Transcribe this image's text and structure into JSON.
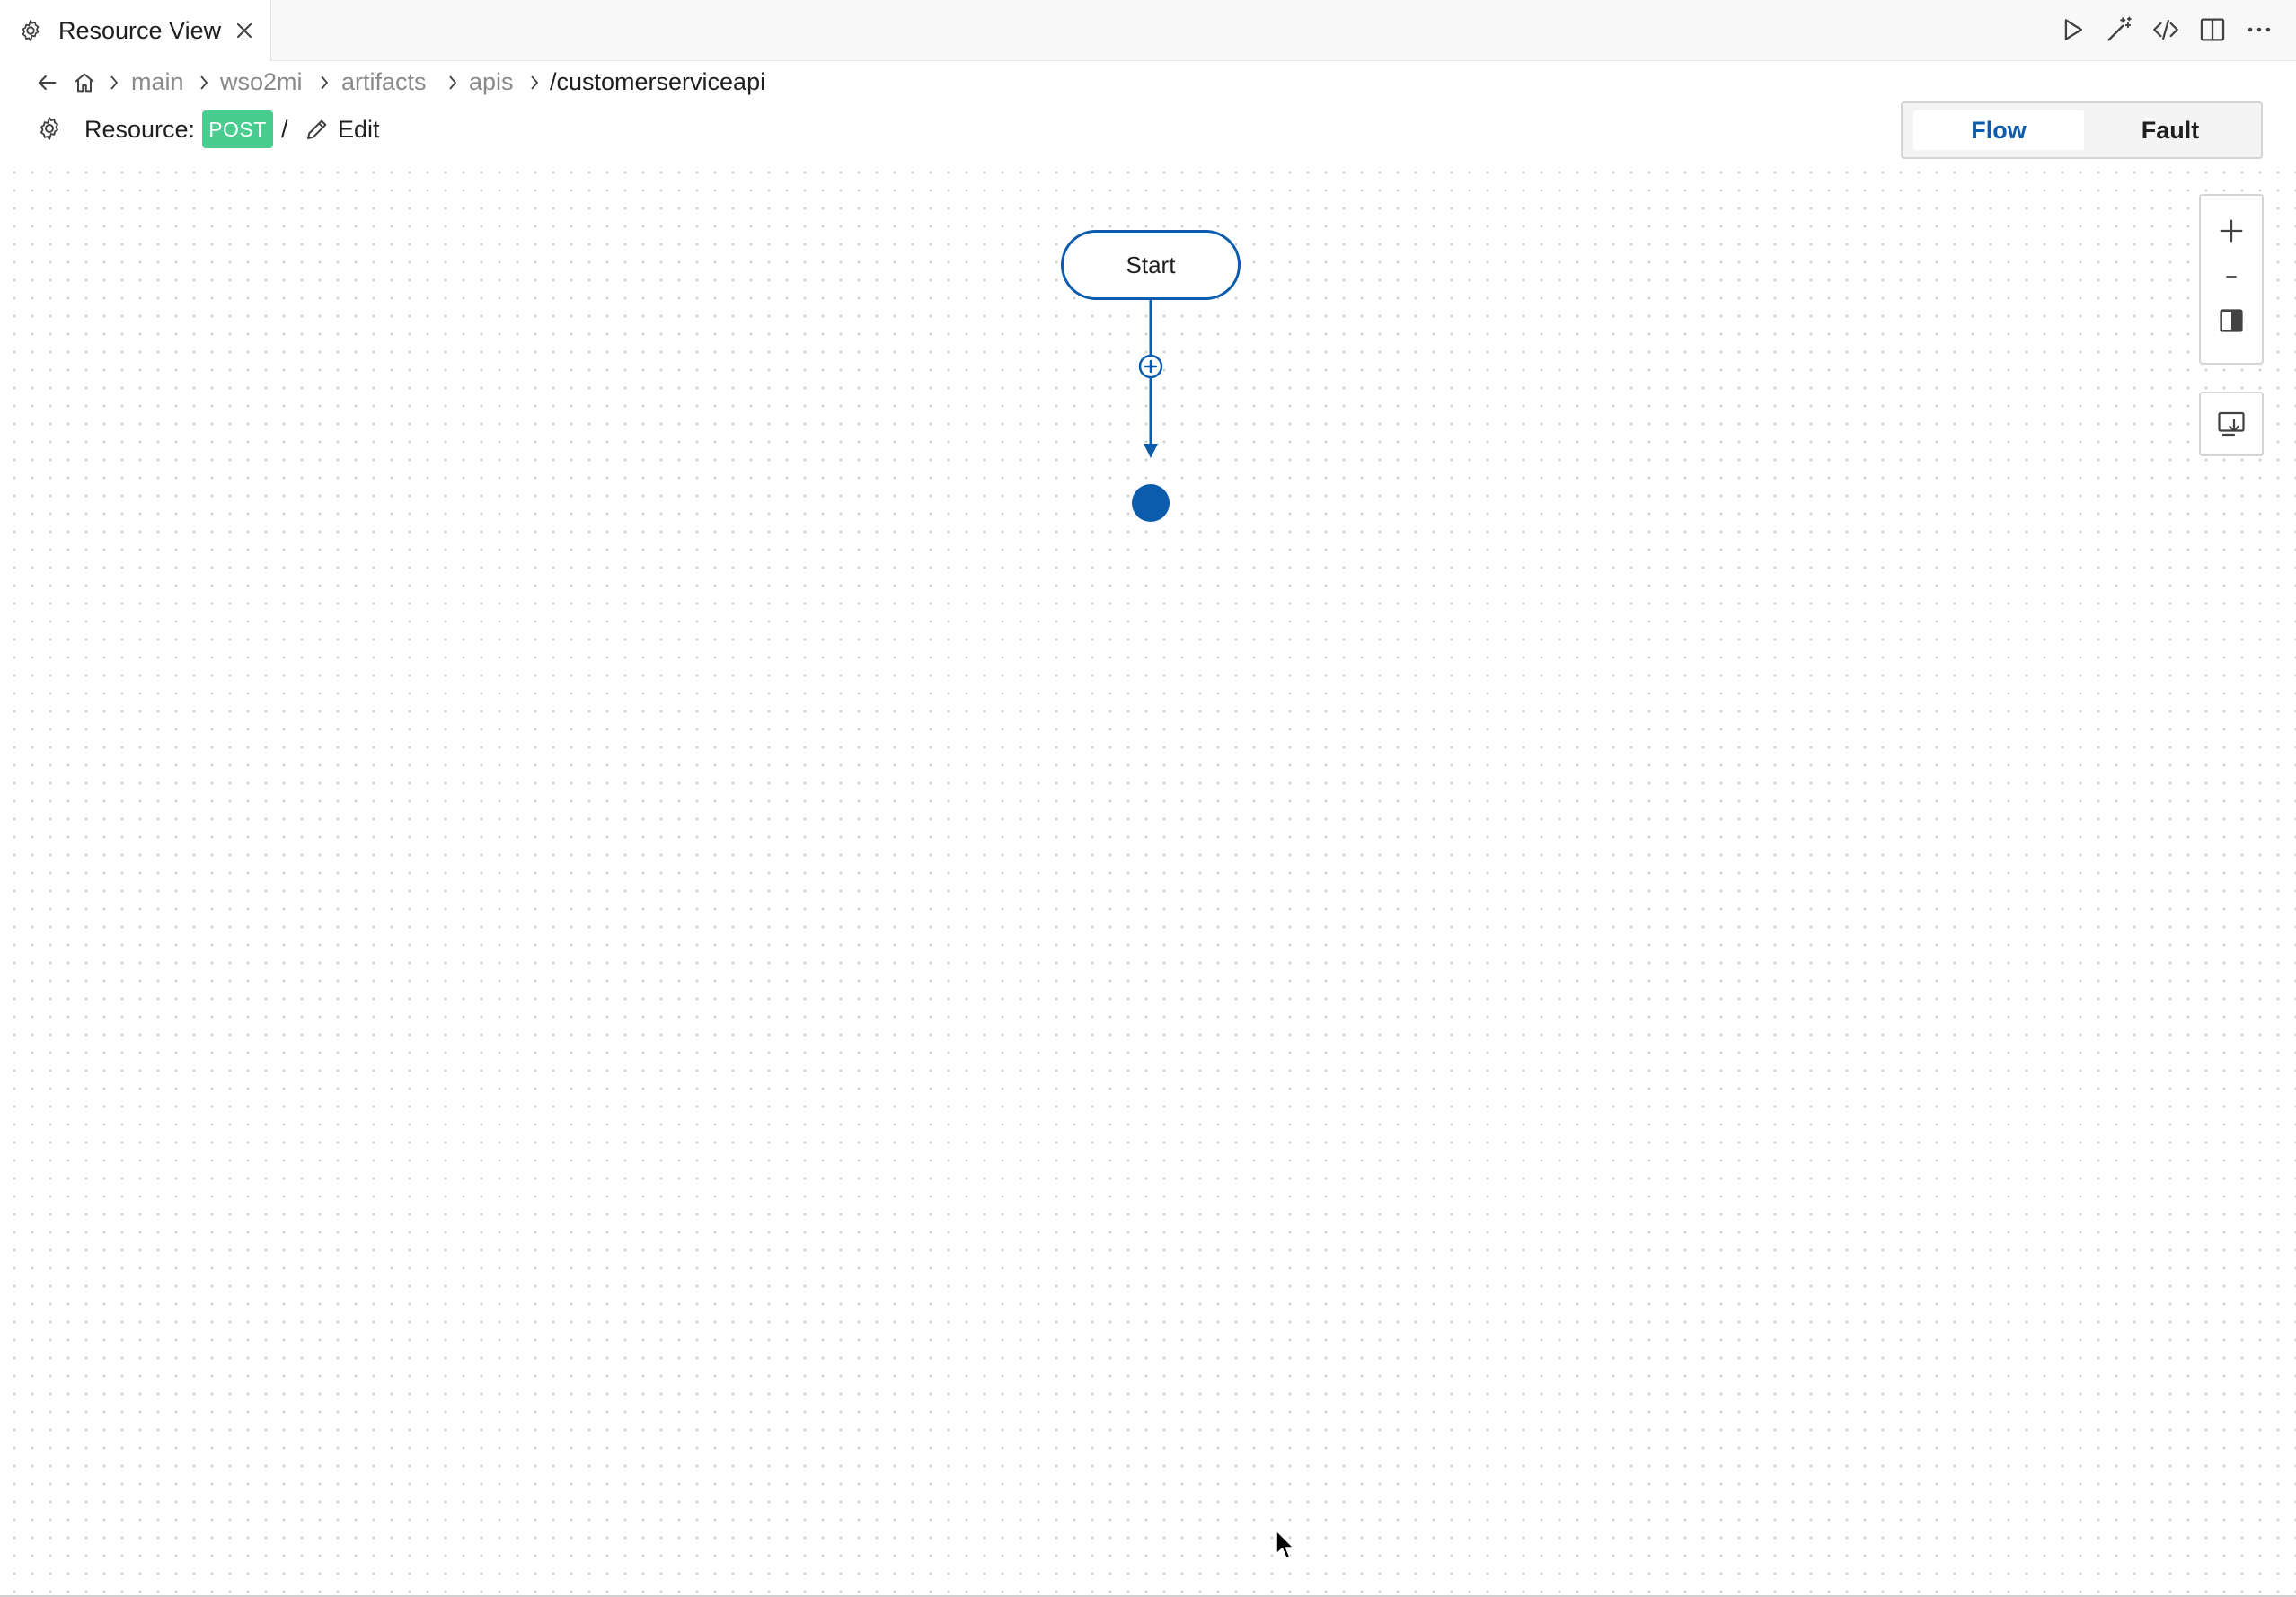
{
  "tab": {
    "title": "Resource View",
    "icon": "gear-icon"
  },
  "editor_actions": [
    "play-icon",
    "magic-wand-icon",
    "code-icon",
    "split-editor-icon",
    "more-icon"
  ],
  "breadcrumb": {
    "items": [
      "main",
      "wso2mi",
      "artifacts",
      "apis"
    ],
    "current": "/customerserviceapi"
  },
  "resource": {
    "label": "Resource:",
    "method": "POST",
    "path": "/",
    "edit_label": "Edit"
  },
  "view_toggle": {
    "options": [
      "Flow",
      "Fault"
    ],
    "active": "Flow"
  },
  "flow": {
    "start_label": "Start"
  },
  "colors": {
    "accent": "#0b5cad",
    "post_badge": "#49cc90"
  }
}
